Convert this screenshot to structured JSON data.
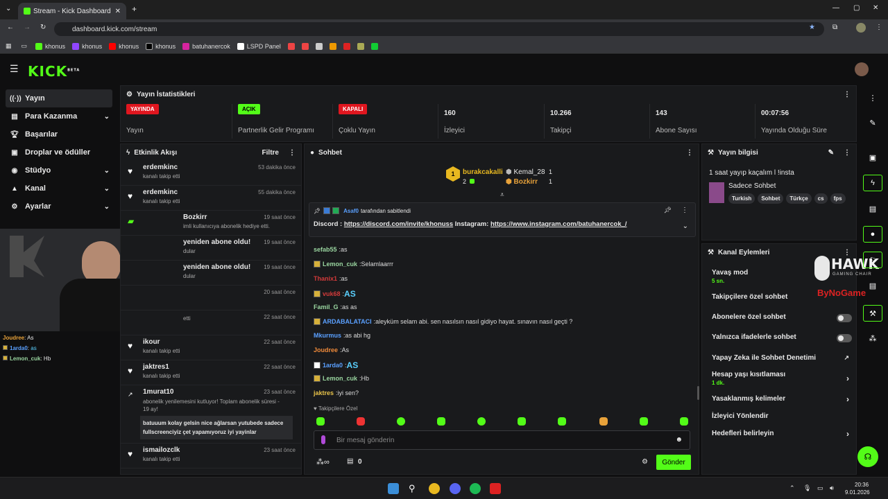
{
  "browser": {
    "tab_title": "Stream - Kick Dashboard",
    "url": "dashboard.kick.com/stream",
    "bookmarks": [
      "khonus",
      "khonus",
      "khonus",
      "khonus",
      "batuhanercok",
      "LSPD Panel"
    ]
  },
  "app": {
    "logo": "KICK",
    "logo_sup": "BETA"
  },
  "sidebar": {
    "items": [
      {
        "label": "Yayın",
        "icon": "broadcast-icon"
      },
      {
        "label": "Para Kazanma",
        "icon": "money-icon"
      },
      {
        "label": "Başarılar",
        "icon": "trophy-icon"
      },
      {
        "label": "Droplar ve ödüller",
        "icon": "gift-icon"
      },
      {
        "label": "Stüdyo",
        "icon": "studio-icon"
      },
      {
        "label": "Kanal",
        "icon": "channel-icon"
      },
      {
        "label": "Ayarlar",
        "icon": "gear-icon"
      }
    ]
  },
  "stats": {
    "title": "Yayın İstatistikleri",
    "items": [
      {
        "badge": "YAYINDA",
        "label": "Yayın"
      },
      {
        "badge": "AÇIK",
        "label": "Partnerlik Gelir Programı"
      },
      {
        "badge": "KAPALI",
        "label": "Çoklu Yayın"
      },
      {
        "value": "160",
        "label": "İzleyici"
      },
      {
        "value": "10.266",
        "label": "Takipçi"
      },
      {
        "value": "143",
        "label": "Abone Sayısı"
      },
      {
        "value": "00:07:56",
        "label": "Yayında Olduğu Süre"
      }
    ]
  },
  "events": {
    "title": "Etkinlik Akışı",
    "filter": "Filtre",
    "items": [
      {
        "name": "erdemkinc",
        "sub": "kanalı takip etti",
        "time": "53 dakika önce"
      },
      {
        "name": "erdemkinc",
        "sub": "kanalı takip etti",
        "time": "55 dakika önce"
      },
      {
        "name": "Bozkirr",
        "sub": "imli kullanıcıya abonelik hediye etti.",
        "time": "19 saat önce"
      },
      {
        "name": "yeniden abone oldu!",
        "sub": "dular",
        "time": "19 saat önce"
      },
      {
        "name": "yeniden abone oldu!",
        "sub": "dular",
        "time": "19 saat önce"
      },
      {
        "name": "",
        "sub": "",
        "time": "20 saat önce"
      },
      {
        "name": "",
        "sub": "etti",
        "time": "22 saat önce"
      },
      {
        "name": "ikour",
        "sub": "kanalı takip etti",
        "time": "22 saat önce"
      },
      {
        "name": "jaktres1",
        "sub": "kanalı takip etti",
        "time": "22 saat önce"
      },
      {
        "name": "1murat10",
        "sub": "abonelik yenilemesini kutluyor! Toplam abonelik süresi - 19 ay!",
        "time": "23 saat önce",
        "note": "batuuum kolay gelsin nice ağlarsan yutubede sadece fullscreenciyiz çet yapamıyoruz iyi yayinlar"
      },
      {
        "name": "ismailozclk",
        "sub": "kanalı takip etti",
        "time": "23 saat önce"
      }
    ]
  },
  "overlay": {
    "lines": [
      {
        "user": "Joudree",
        "text": "As"
      },
      {
        "user": "1arda0",
        "text": "as"
      },
      {
        "user": "Lemon_cuk",
        "text": "Hb"
      }
    ]
  },
  "chat": {
    "title": "Sohbet",
    "top": [
      {
        "rank": "1",
        "name": "burakcakalli",
        "count": "2"
      },
      {
        "name": "Kemal_28",
        "count": "1"
      },
      {
        "name": "Bozkirr",
        "count": "1"
      }
    ],
    "pinned_by": "Asaf0",
    "pinned_suffix": "tarafından sabitlendi",
    "pinned_text": "Discord :",
    "pinned_link1": "https://discord.com/invite/khonuss",
    "pinned_mid": "Instagram:",
    "pinned_link2": "https://www.instagram.com/batuhanercok_/",
    "messages": [
      {
        "user": "sefab55",
        "text": "as",
        "color": "#9ad6a0"
      },
      {
        "user": "Lemon_cuk",
        "text": "Selamlaarrr",
        "color": "#9ad6a0"
      },
      {
        "user": "Thanix1",
        "text": "as",
        "color": "#d23a3a"
      },
      {
        "user": "vuk68",
        "text": "AS",
        "color": "#d23a3a"
      },
      {
        "user": "Famil_G",
        "text": "as as",
        "color": "#9ad6a0"
      },
      {
        "user": "ARDABALATACI",
        "text": "aleyküm selam abi. sen nasılsın nasıl gidiyo hayat. sınavın nasıl geçti ?",
        "color": "#5aa0ff"
      },
      {
        "user": "Mkurmus",
        "text": "as abi hg",
        "color": "#5aa0ff"
      },
      {
        "user": "Joudree",
        "text": "As",
        "color": "#f08a3a"
      },
      {
        "user": "1arda0",
        "text": "AS",
        "color": "#5aa0ff"
      },
      {
        "user": "Lemon_cuk",
        "text": "Hb",
        "color": "#9ad6a0"
      },
      {
        "user": "jaktres",
        "text": "iyi sen?",
        "color": "#e8c34a"
      }
    ],
    "followers_only": "Takipçilere Özel",
    "input_placeholder": "Bir mesaj gönderin",
    "count": "0",
    "send": "Gönder"
  },
  "info": {
    "title": "Yayın bilgisi",
    "stream_title": "1 saat yayıp kaçalım l !insta",
    "category": "Sadece Sohbet",
    "tags": [
      "Turkish",
      "Sohbet",
      "Türkçe",
      "cs",
      "fps"
    ]
  },
  "actions": {
    "title": "Kanal Eylemleri",
    "items": [
      {
        "label": "Yavaş mod",
        "sub": "5 sn."
      },
      {
        "label": "Takipçilere özel sohbet"
      },
      {
        "label": "Abonelere özel sohbet"
      },
      {
        "label": "Yalnızca ifadelerle sohbet"
      },
      {
        "label": "Yapay Zeka ile Sohbet Denetimi"
      },
      {
        "label": "Hesap yaşı kısıtlaması",
        "sub": "1 dk."
      },
      {
        "label": "Yasaklanmış kelimeler"
      },
      {
        "label": "İzleyici Yönlendir"
      },
      {
        "label": "Hedefleri belirleyin"
      }
    ]
  },
  "watermark": {
    "brand": "HAWK",
    "tagline": "GAMING CHAIR",
    "sponsor": "ByNoGame"
  },
  "taskbar": {
    "time": "20:36",
    "date": "9.01.2026"
  },
  "colors": {
    "accent": "#53fc18",
    "live": "#e0161f",
    "panel": "#191a1c"
  }
}
